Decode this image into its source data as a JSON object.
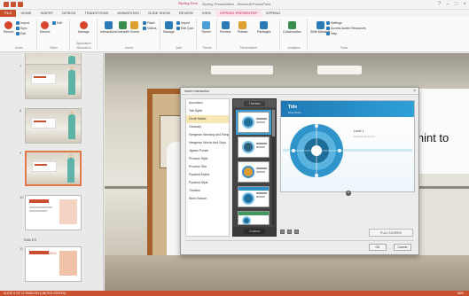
{
  "titlebar": {
    "window_title": "iSpring Presentation - Microsoft PowerPoint",
    "context_tab_group": "iSpring Free"
  },
  "tabs": [
    "FILE",
    "HOME",
    "INSERT",
    "DESIGN",
    "TRANSITIONS",
    "ANIMATIONS",
    "SLIDE SHOW",
    "REVIEW",
    "VIEW",
    "ISPRING PRESENTER",
    "iSPRING"
  ],
  "ribbon": {
    "groups": {
      "audio": "Audio",
      "video": "Video",
      "application_simulation": "Application Simulation",
      "insert": "Insert",
      "quiz": "Quiz",
      "presentation": "Presentation",
      "analytics": "Analytics",
      "tools": "Tools",
      "theme": "Theme"
    },
    "buttons": {
      "record": "Record",
      "manage_audio": "Manage",
      "record_video": "Record",
      "interactions": "Interactions",
      "character": "Character",
      "scene": "Scene",
      "manage_quiz": "Manage",
      "theme": "Theme",
      "preview": "Preview",
      "publish": "Publish",
      "packages": "Packages",
      "collaboration": "Collaboration",
      "slide_manager": "Slide Manager",
      "settings": "Settings",
      "access_adobe": "Access Adobe Resources",
      "help": "Help",
      "import": "Import",
      "sync": "Sync",
      "edit": "Edit",
      "flash": "Flash",
      "videos": "Videos",
      "youtube": "YouTube",
      "edit_quiz": "Edit Quiz"
    }
  },
  "slides": {
    "numbers": [
      "7",
      "8",
      "9",
      "10",
      "11"
    ],
    "section_label": "TABLES",
    "selected_number": "9",
    "thumbnail_caption": "PowerPoint 2013"
  },
  "slide": {
    "hint_line1": "e hint to",
    "hint_line2": "..."
  },
  "dialog": {
    "title": "Insert Interaction",
    "close": "×",
    "list": [
      "Accordion",
      "Tab Styler",
      "Circle Matrix",
      "Glossary",
      "Hangman Wording And Range",
      "Hangman Words And Sayz",
      "Jigsaw Puzzle",
      "Process Style",
      "Process Title",
      "Pyramid Matrix",
      "Pyramid Style",
      "Timeline",
      "Word Search"
    ],
    "selected_item": "Circle Matrix",
    "themes_label": "Themes",
    "custom_label": "Custom",
    "preview": {
      "title": "Title",
      "description": "Description",
      "level_label": "Level 1",
      "level_desc": "Replace text here"
    },
    "fullscreen_label": "FULL SCREEN",
    "ok_label": "OK",
    "cancel_label": "Cancel"
  },
  "statusbar": {
    "text": "SLIDE 9 OF 12   ENGLISH (UNITED STATES)",
    "zoom": "68%"
  },
  "colors": {
    "accent": "#c9512f",
    "preview_blue": "#1f78b4",
    "matrix_inner": "#1f6e98"
  }
}
